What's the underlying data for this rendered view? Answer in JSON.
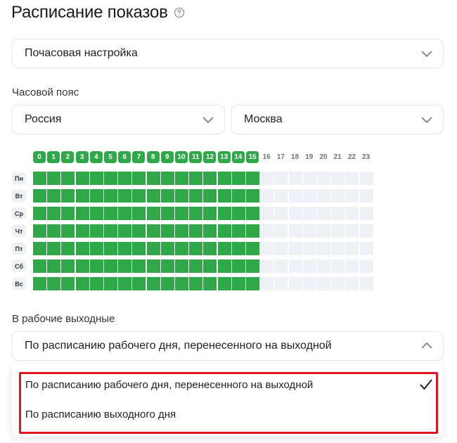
{
  "title": "Расписание показов",
  "mode_select": {
    "value": "Почасовая настройка"
  },
  "timezone": {
    "label": "Часовой пояс",
    "country": "Россия",
    "city": "Москва"
  },
  "schedule": {
    "hours": [
      "0",
      "1",
      "2",
      "3",
      "4",
      "5",
      "6",
      "7",
      "8",
      "9",
      "10",
      "11",
      "12",
      "13",
      "14",
      "15",
      "16",
      "17",
      "18",
      "19",
      "20",
      "21",
      "22",
      "23"
    ],
    "active_hour_count": 16,
    "days": [
      "Пн",
      "Вт",
      "Ср",
      "Чт",
      "Пт",
      "Сб",
      "Вс"
    ]
  },
  "workdays": {
    "label": "В рабочие выходные",
    "selected": "По расписанию рабочего дня, перенесенного на выходной",
    "options": [
      "По расписанию рабочего дня, перенесенного на выходной",
      "По расписанию выходного дня"
    ]
  },
  "colors": {
    "active": "#2fa84a",
    "inactive": "#eef1f5",
    "highlight": "#e0141e"
  }
}
